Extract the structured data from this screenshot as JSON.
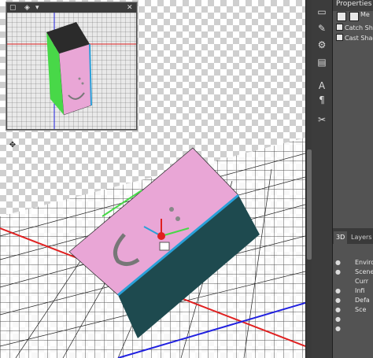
{
  "navigator": {
    "title_icons": [
      "view-icon",
      "camera-icon"
    ]
  },
  "properties": {
    "title": "Properties",
    "top_label": "Me",
    "checkboxes": [
      {
        "label": "Catch Shado",
        "checked": true
      },
      {
        "label": "Cast Shadov",
        "checked": true
      }
    ]
  },
  "layers_panel": {
    "tabs": [
      "3D",
      "Layers"
    ],
    "rows": [
      "Enviro",
      "Scene",
      "Curr",
      "Infi",
      "Defa",
      "Sce",
      "",
      ""
    ]
  },
  "colors": {
    "box_top": "#e9a6d6",
    "box_side": "#1e4a4f",
    "edge_green": "#48d848",
    "edge_blue": "#2aa0d8",
    "axis_red": "#e02020",
    "axis_blue": "#2020e0"
  }
}
